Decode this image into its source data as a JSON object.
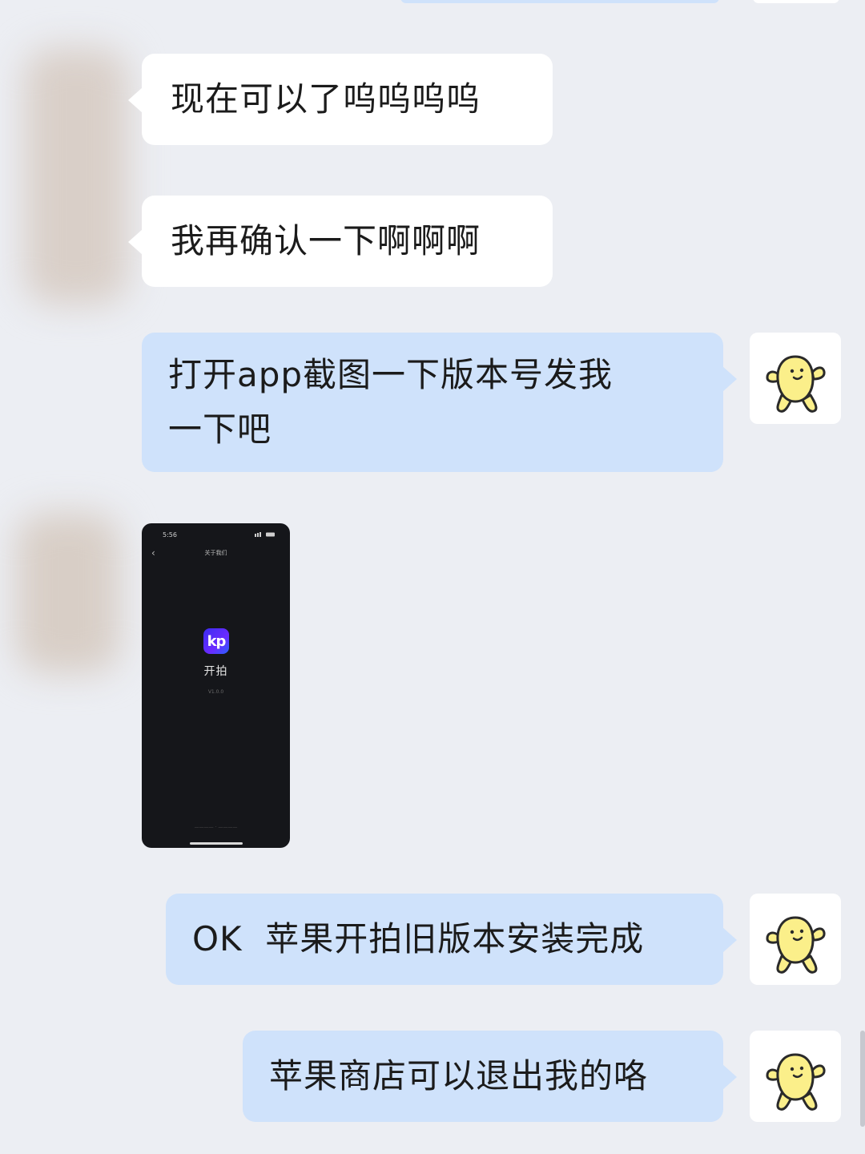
{
  "messages": [
    {
      "side": "in",
      "kind": "text",
      "text": "现在可以了呜呜呜呜"
    },
    {
      "side": "in",
      "kind": "text",
      "text": "我再确认一下啊啊啊"
    },
    {
      "side": "out",
      "kind": "text",
      "lines": [
        "打开app截图一下版本号发我",
        "一下吧"
      ]
    },
    {
      "side": "in",
      "kind": "image",
      "image": {
        "status_time": "5:56",
        "nav_title": "关于我们",
        "app_icon_letter": "kp",
        "app_name": "开拍",
        "app_version": "V1.0.0"
      }
    },
    {
      "side": "out",
      "kind": "text",
      "text": "OK  苹果开拍旧版本安装完成"
    },
    {
      "side": "out",
      "kind": "text",
      "text": "苹果商店可以退出我的咯"
    }
  ],
  "self_avatar_icon": "yellow-blob-character-icon",
  "colors": {
    "background": "#eceef3",
    "incoming_bubble": "#ffffff",
    "outgoing_bubble": "#cfe2fb",
    "avatar_character": "#fbef8a"
  }
}
